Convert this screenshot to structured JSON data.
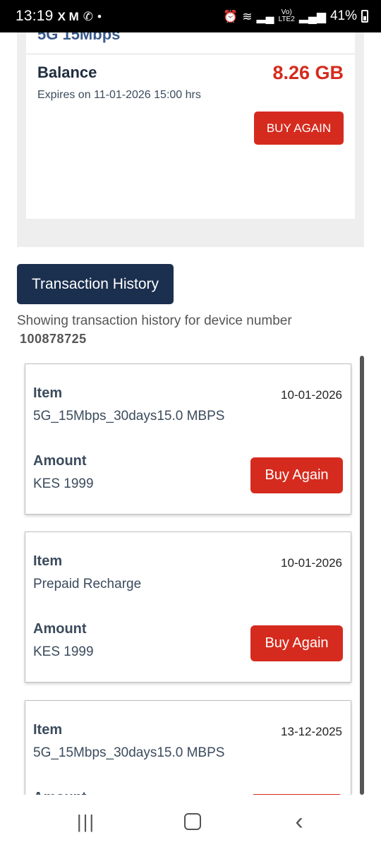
{
  "status_bar": {
    "time": "13:19",
    "notification_glyphs": "X M",
    "whatsapp_glyph": "✆",
    "dot": "•",
    "battery_percent": "41%",
    "volte_label": "Vo)",
    "lte_label": "LTE2"
  },
  "plan": {
    "name": "5G 15Mbps",
    "balance_label": "Balance",
    "balance_value": "8.26 GB",
    "expires_text": "Expires on 11-01-2026 15:00 hrs",
    "buy_again_label": "BUY AGAIN"
  },
  "transactions": {
    "tab_label": "Transaction History",
    "intro_text": "Showing transaction history for device number",
    "device_number": "100878725",
    "item_label": "Item",
    "amount_label": "Amount",
    "buy_again_label": "Buy Again",
    "rows": [
      {
        "item": "5G_15Mbps_30days15.0 MBPS",
        "date": "10-01-2026",
        "amount": "KES 1999"
      },
      {
        "item": "Prepaid Recharge",
        "date": "10-01-2026",
        "amount": "KES 1999"
      },
      {
        "item": "5G_15Mbps_30days15.0 MBPS",
        "date": "13-12-2025",
        "amount": ""
      }
    ]
  },
  "nav": {
    "recent_glyph": "|||",
    "back_glyph": "‹"
  },
  "colors": {
    "accent_red": "#d52b1e",
    "navy": "#1b2f4e"
  }
}
